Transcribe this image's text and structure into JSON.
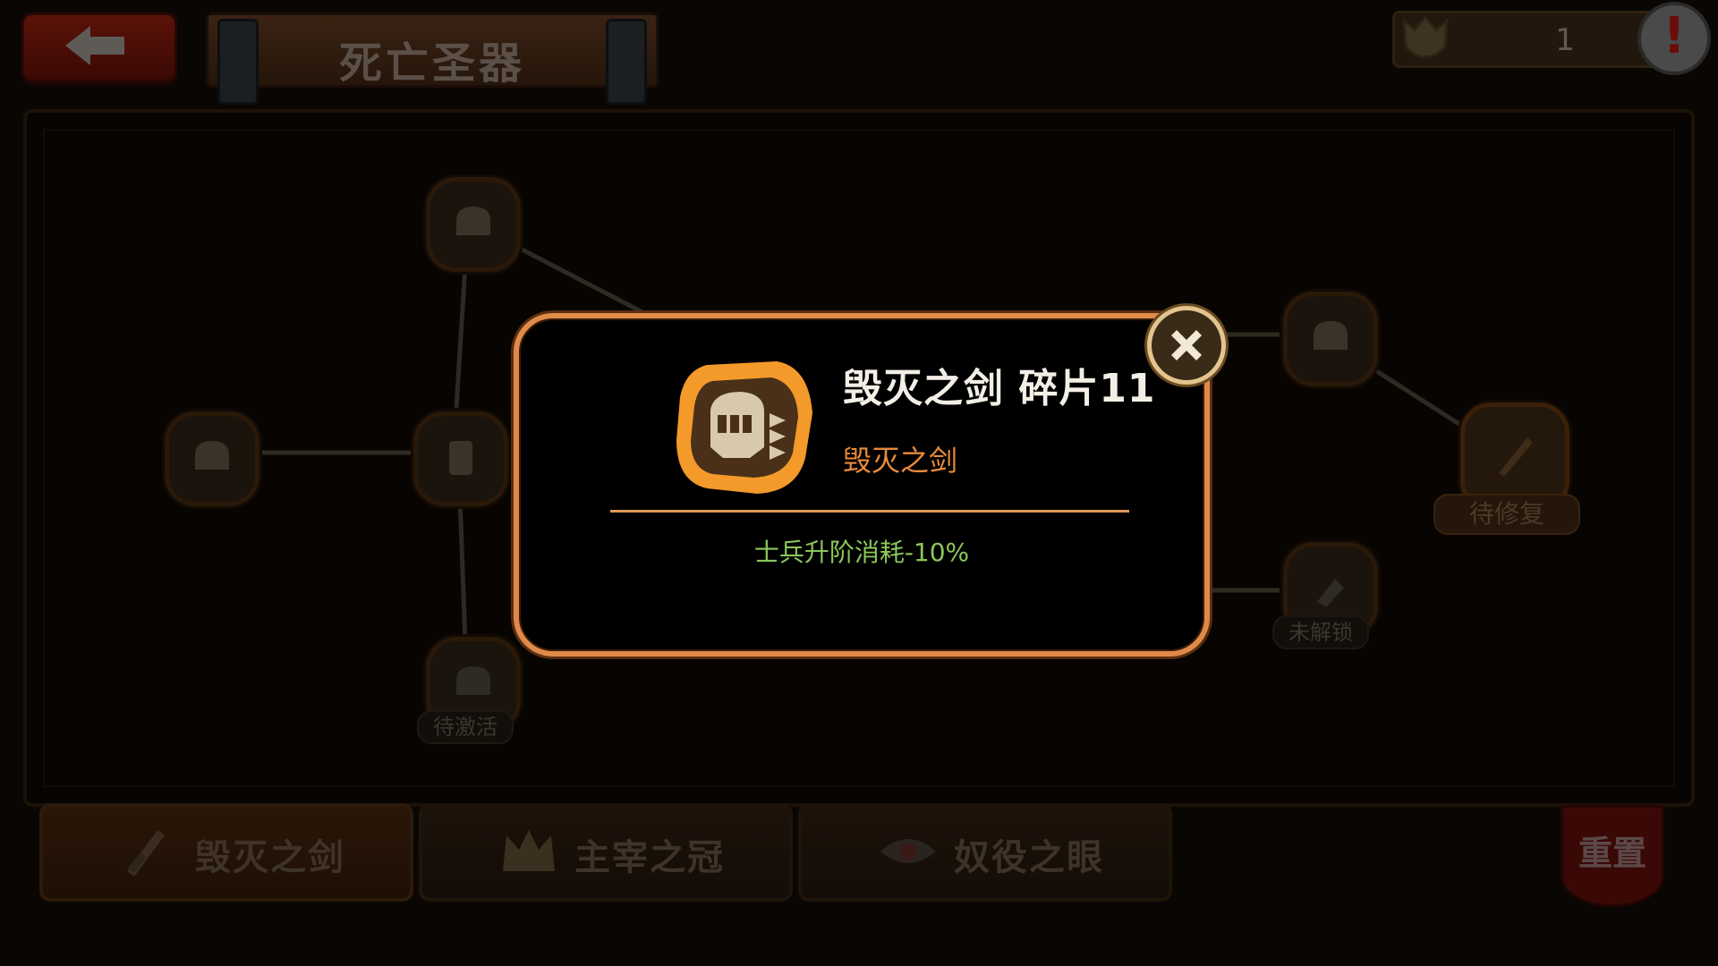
{
  "header": {
    "title": "死亡圣器",
    "currency_value": "1",
    "alert_mark": "!"
  },
  "tree": {
    "node_tags": [
      {
        "label": "待激活"
      },
      {
        "label": "未解锁"
      },
      {
        "label": "待修复"
      }
    ]
  },
  "tabs": [
    {
      "label": "毁灭之剑"
    },
    {
      "label": "主宰之冠"
    },
    {
      "label": "奴役之眼"
    }
  ],
  "reset_label": "重置",
  "modal": {
    "title": "毁灭之剑 碎片11",
    "subtitle": "毁灭之剑",
    "effect": "士兵升阶消耗-10%"
  },
  "colors": {
    "modal_border": "#e08a4a",
    "subtitle": "#e88a3c",
    "effect": "#8bc65a",
    "badge_fill": "#f39a2a"
  },
  "icons": {
    "back": "arrow-left-icon",
    "close": "close-x-icon",
    "alert": "exclamation-icon",
    "badge": "knight-helmet-icon"
  }
}
